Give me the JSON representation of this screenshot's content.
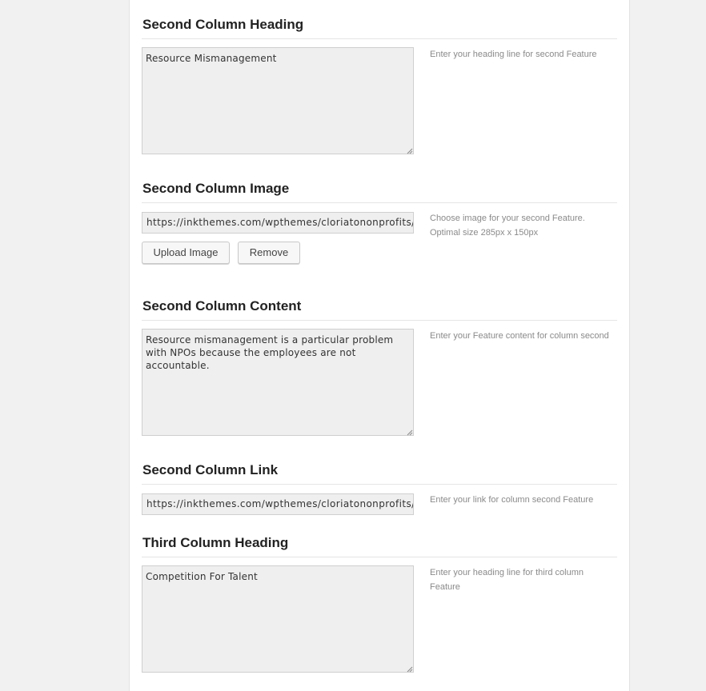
{
  "sections": [
    {
      "heading": "Second Column Heading",
      "value": "Resource Mismanagement",
      "help": "Enter your heading line for second Feature"
    },
    {
      "heading": "Second Column Image",
      "value": "https://inkthemes.com/wpthemes/cloriatononprofits/wp",
      "help": "Choose image for your second Feature. Optimal size 285px x 150px",
      "upload_label": "Upload Image",
      "remove_label": "Remove"
    },
    {
      "heading": "Second Column Content",
      "value": "Resource mismanagement is a particular problem with NPOs because the employees are not accountable.",
      "help": "Enter your Feature content for column second"
    },
    {
      "heading": "Second Column Link",
      "value": "https://inkthemes.com/wpthemes/cloriatononprofits/gi",
      "help": "Enter your link for column second Feature"
    },
    {
      "heading": "Third Column Heading",
      "value": "Competition For Talent",
      "help": "Enter your heading line for third column Feature"
    }
  ]
}
